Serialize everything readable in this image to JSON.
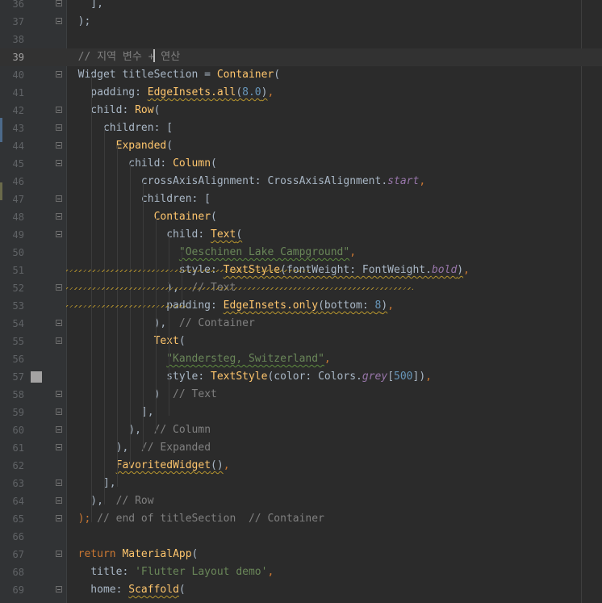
{
  "editor": {
    "file_kind": "dart",
    "colors": {
      "background": "#2b2b2b",
      "gutter": "#313335",
      "keyword": "#cc7832",
      "class": "#ffc66d",
      "string": "#6a8759",
      "number": "#6897bb",
      "property": "#9876aa",
      "comment": "#808080",
      "text": "#a9b7c6"
    },
    "current_line": 39,
    "bookmarked_line": 57,
    "lines": [
      {
        "n": "36",
        "fold": true,
        "tokens": [
          {
            "t": "    ],",
            "k": "plain"
          }
        ]
      },
      {
        "n": "37",
        "fold": true,
        "tokens": [
          {
            "t": "  );",
            "k": "plain"
          }
        ]
      },
      {
        "n": "38",
        "fold": false,
        "tokens": []
      },
      {
        "n": "39",
        "fold": false,
        "tokens": [
          {
            "t": "  // 지역 변수 + 연산",
            "k": "cm"
          }
        ]
      },
      {
        "n": "40",
        "fold": true,
        "tokens": [
          {
            "t": "  Widget titleSection = ",
            "k": "plain"
          },
          {
            "t": "Container",
            "k": "cls"
          },
          {
            "t": "(",
            "k": "plain"
          }
        ]
      },
      {
        "n": "41",
        "fold": false,
        "tokens": [
          {
            "t": "    padding: ",
            "k": "plain"
          },
          {
            "t": "EdgeInsets.all",
            "k": "cls",
            "w": true
          },
          {
            "t": "(",
            "k": "plain",
            "w": true
          },
          {
            "t": "8.0",
            "k": "num",
            "w": true
          },
          {
            "t": ")",
            "k": "plain",
            "w": true
          },
          {
            "t": ",",
            "k": "kw"
          }
        ]
      },
      {
        "n": "42",
        "fold": true,
        "tokens": [
          {
            "t": "    child: ",
            "k": "plain"
          },
          {
            "t": "Row",
            "k": "cls"
          },
          {
            "t": "(",
            "k": "plain"
          }
        ]
      },
      {
        "n": "43",
        "fold": true,
        "tokens": [
          {
            "t": "      children: [",
            "k": "plain"
          }
        ]
      },
      {
        "n": "44",
        "fold": true,
        "tokens": [
          {
            "t": "        ",
            "k": "plain"
          },
          {
            "t": "Expanded",
            "k": "cls"
          },
          {
            "t": "(",
            "k": "plain"
          }
        ]
      },
      {
        "n": "45",
        "fold": true,
        "tokens": [
          {
            "t": "          child: ",
            "k": "plain"
          },
          {
            "t": "Column",
            "k": "cls"
          },
          {
            "t": "(",
            "k": "plain"
          }
        ]
      },
      {
        "n": "46",
        "fold": false,
        "tokens": [
          {
            "t": "            crossAxisAlignment: CrossAxisAlignment.",
            "k": "plain"
          },
          {
            "t": "start",
            "k": "prop"
          },
          {
            "t": ",",
            "k": "kw"
          }
        ]
      },
      {
        "n": "47",
        "fold": true,
        "tokens": [
          {
            "t": "            children: [",
            "k": "plain"
          }
        ]
      },
      {
        "n": "48",
        "fold": true,
        "tokens": [
          {
            "t": "              ",
            "k": "plain"
          },
          {
            "t": "Container",
            "k": "cls"
          },
          {
            "t": "(",
            "k": "plain"
          }
        ]
      },
      {
        "n": "49",
        "fold": true,
        "tokens": [
          {
            "t": "                child: ",
            "k": "plain"
          },
          {
            "t": "Text",
            "k": "cls",
            "w": true
          },
          {
            "t": "(",
            "k": "plain",
            "w": true
          }
        ]
      },
      {
        "n": "50",
        "fold": false,
        "tokens": [
          {
            "t": "                  ",
            "k": "plain"
          },
          {
            "t": "\"Oeschinen Lake Campground\"",
            "k": "str",
            "w": true
          },
          {
            "t": ",",
            "k": "kw"
          }
        ]
      },
      {
        "n": "51",
        "fold": false,
        "tokens": [
          {
            "t": "                  style: ",
            "k": "plain"
          },
          {
            "t": "TextStyle",
            "k": "cls",
            "w": true
          },
          {
            "t": "(fontWeight: FontWeight.",
            "k": "plain",
            "w": true
          },
          {
            "t": "bold",
            "k": "prop",
            "w": true
          },
          {
            "t": ")",
            "k": "plain",
            "w": true
          },
          {
            "t": ",",
            "k": "kw"
          }
        ]
      },
      {
        "n": "52",
        "fold": true,
        "tokens": [
          {
            "t": "                ),",
            "k": "plain"
          },
          {
            "t": "  // Text",
            "k": "cm"
          }
        ]
      },
      {
        "n": "53",
        "fold": false,
        "tokens": [
          {
            "t": "                padding: ",
            "k": "plain"
          },
          {
            "t": "EdgeInsets.only",
            "k": "cls",
            "w": true
          },
          {
            "t": "(bottom: ",
            "k": "plain",
            "w": true
          },
          {
            "t": "8",
            "k": "num",
            "w": true
          },
          {
            "t": ")",
            "k": "plain",
            "w": true
          },
          {
            "t": ",",
            "k": "kw"
          }
        ]
      },
      {
        "n": "54",
        "fold": true,
        "tokens": [
          {
            "t": "              ),",
            "k": "plain"
          },
          {
            "t": "  // Container",
            "k": "cm"
          }
        ]
      },
      {
        "n": "55",
        "fold": true,
        "tokens": [
          {
            "t": "              ",
            "k": "plain"
          },
          {
            "t": "Text",
            "k": "cls"
          },
          {
            "t": "(",
            "k": "plain"
          }
        ]
      },
      {
        "n": "56",
        "fold": false,
        "tokens": [
          {
            "t": "                ",
            "k": "plain"
          },
          {
            "t": "\"Kandersteg, Switzerland\"",
            "k": "str",
            "w": true
          },
          {
            "t": ",",
            "k": "kw"
          }
        ]
      },
      {
        "n": "57",
        "fold": false,
        "tokens": [
          {
            "t": "                style: ",
            "k": "plain"
          },
          {
            "t": "TextStyle",
            "k": "cls"
          },
          {
            "t": "(color: Colors.",
            "k": "plain"
          },
          {
            "t": "grey",
            "k": "prop"
          },
          {
            "t": "[",
            "k": "plain"
          },
          {
            "t": "500",
            "k": "num"
          },
          {
            "t": "])",
            "k": "plain"
          },
          {
            "t": ",",
            "k": "kw"
          }
        ]
      },
      {
        "n": "58",
        "fold": true,
        "tokens": [
          {
            "t": "              )",
            "k": "plain"
          },
          {
            "t": "  // Text",
            "k": "cm"
          }
        ]
      },
      {
        "n": "59",
        "fold": true,
        "tokens": [
          {
            "t": "            ],",
            "k": "plain"
          }
        ]
      },
      {
        "n": "60",
        "fold": true,
        "tokens": [
          {
            "t": "          ),",
            "k": "plain"
          },
          {
            "t": "  // Column",
            "k": "cm"
          }
        ]
      },
      {
        "n": "61",
        "fold": true,
        "tokens": [
          {
            "t": "        ),",
            "k": "plain"
          },
          {
            "t": "  // Expanded",
            "k": "cm"
          }
        ]
      },
      {
        "n": "62",
        "fold": false,
        "tokens": [
          {
            "t": "        ",
            "k": "plain"
          },
          {
            "t": "FavoritedWidget",
            "k": "cls",
            "w": true
          },
          {
            "t": "()",
            "k": "plain",
            "w": true
          },
          {
            "t": ",",
            "k": "kw"
          }
        ]
      },
      {
        "n": "63",
        "fold": true,
        "tokens": [
          {
            "t": "      ],",
            "k": "plain"
          }
        ]
      },
      {
        "n": "64",
        "fold": true,
        "tokens": [
          {
            "t": "    ),",
            "k": "plain"
          },
          {
            "t": "  // Row",
            "k": "cm"
          }
        ]
      },
      {
        "n": "65",
        "fold": true,
        "tokens": [
          {
            "t": "  );",
            "k": "kw"
          },
          {
            "t": " // end of titleSection  // Container",
            "k": "cm"
          }
        ]
      },
      {
        "n": "66",
        "fold": false,
        "tokens": []
      },
      {
        "n": "67",
        "fold": true,
        "tokens": [
          {
            "t": "  ",
            "k": "plain"
          },
          {
            "t": "return ",
            "k": "kw"
          },
          {
            "t": "MaterialApp",
            "k": "cls"
          },
          {
            "t": "(",
            "k": "plain"
          }
        ]
      },
      {
        "n": "68",
        "fold": false,
        "tokens": [
          {
            "t": "    title: ",
            "k": "plain"
          },
          {
            "t": "'Flutter Layout demo'",
            "k": "str"
          },
          {
            "t": ",",
            "k": "kw"
          }
        ]
      },
      {
        "n": "69",
        "fold": true,
        "tokens": [
          {
            "t": "    home: ",
            "k": "plain"
          },
          {
            "t": "Scaffold",
            "k": "cls",
            "w": true
          },
          {
            "t": "(",
            "k": "plain"
          }
        ]
      }
    ]
  }
}
